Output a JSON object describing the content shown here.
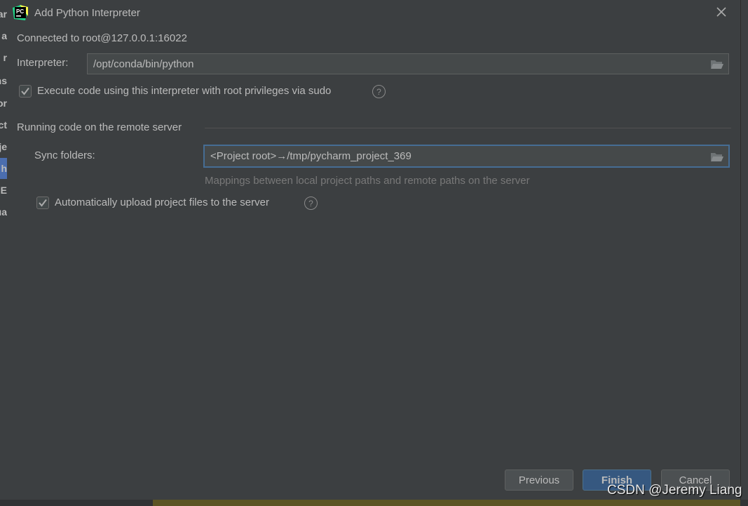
{
  "background_ide": {
    "sidebar_fragments": [
      "ar",
      "a",
      "r",
      "ns",
      "or",
      "ct",
      "je",
      "h",
      "E",
      "ua"
    ]
  },
  "dialog": {
    "title": "Add Python Interpreter",
    "logo_text": "PC",
    "connection": "Connected to root@127.0.0.1:16022",
    "interpreter_label": "Interpreter:",
    "interpreter_value": "/opt/conda/bin/python",
    "sudo_checkbox": {
      "label": "Execute code using this interpreter with root privileges via sudo",
      "checked": true
    },
    "section_title": "Running code on the remote server",
    "sync_label": "Sync folders:",
    "sync_value": "<Project root>→/tmp/pycharm_project_369",
    "sync_hint": "Mappings between local project paths and remote paths on the server",
    "upload_checkbox": {
      "label": "Automatically upload project files to the server",
      "checked": true
    },
    "help_glyph": "?",
    "buttons": {
      "previous": "Previous",
      "finish": "Finish",
      "cancel": "Cancel"
    }
  },
  "watermark": "CSDN @Jeremy Liang",
  "colors": {
    "dialog_bg": "#3c3f41",
    "accent": "#365880",
    "focus_border": "#466d94"
  }
}
